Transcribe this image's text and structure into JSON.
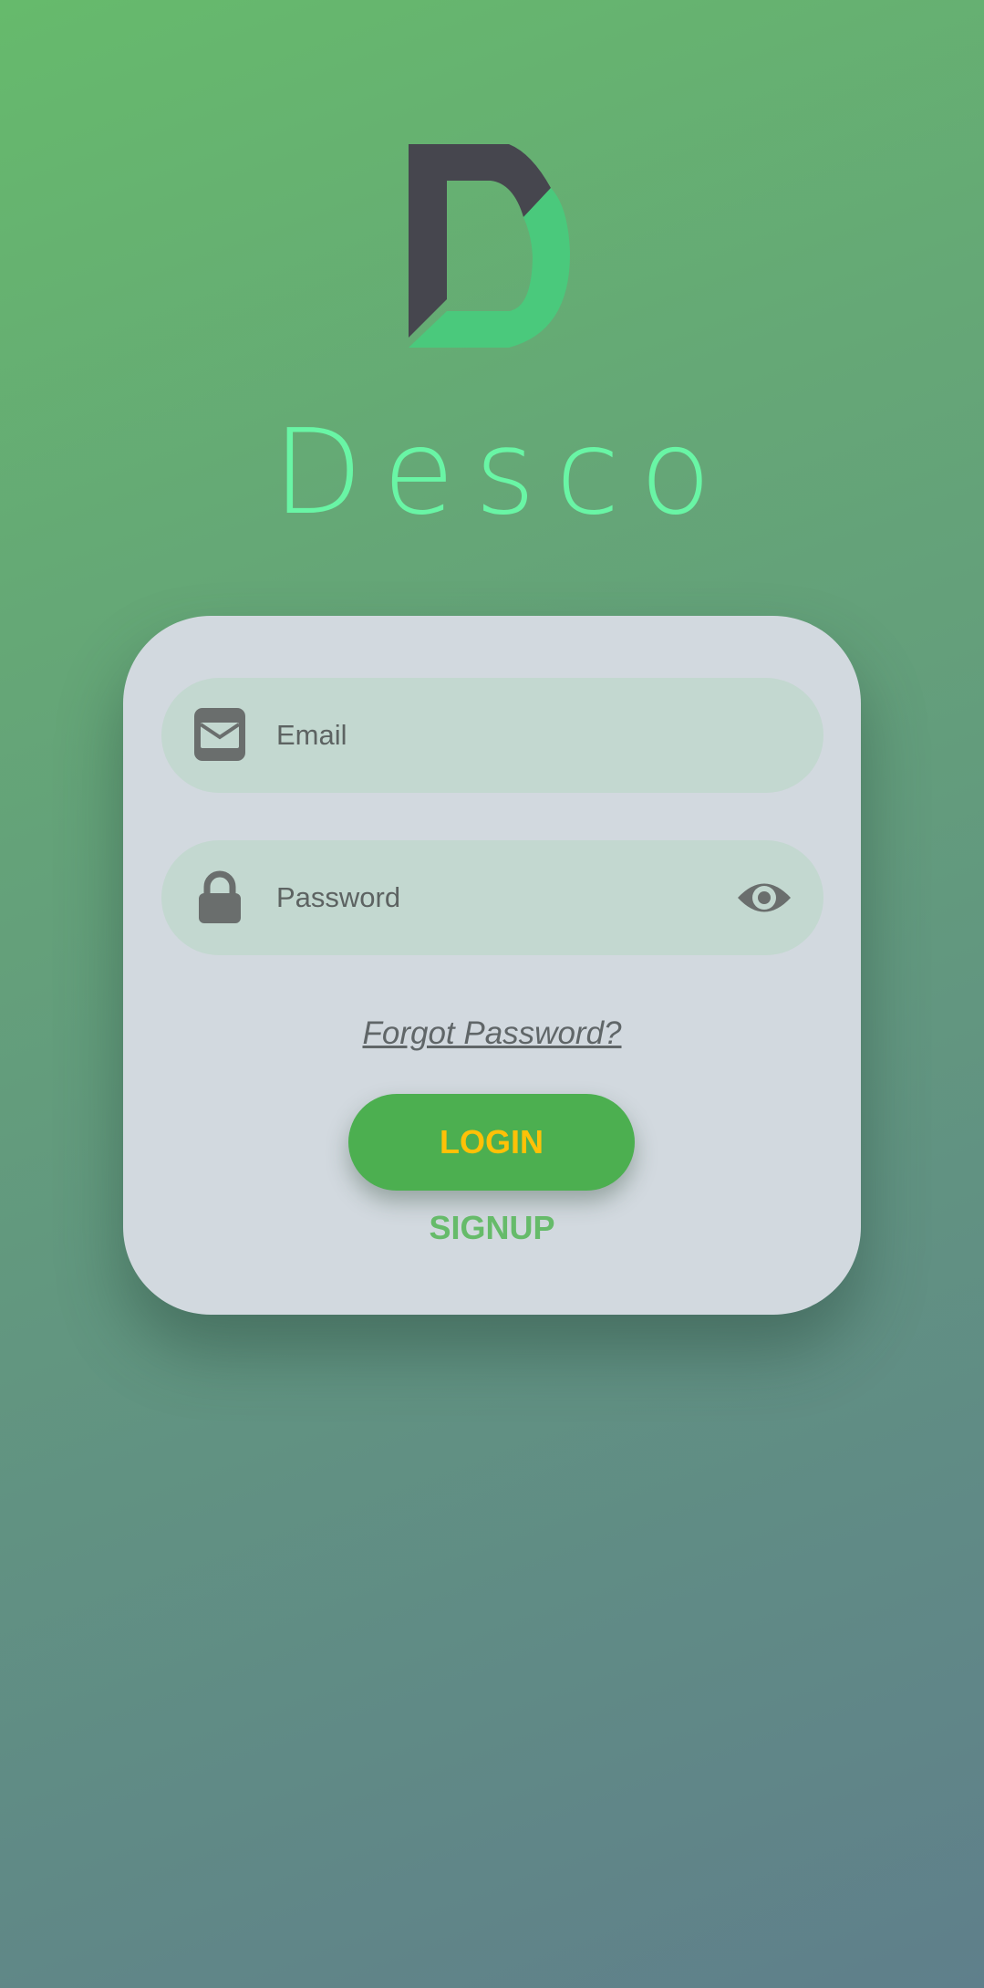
{
  "app": {
    "name": "Desco"
  },
  "login_form": {
    "email_placeholder": "Email",
    "password_placeholder": "Password",
    "forgot_password_label": "Forgot Password?",
    "login_label": "LOGIN",
    "signup_label": "SIGNUP"
  },
  "icons": {
    "logo": "desco-d-logo",
    "email": "envelope-icon",
    "password": "lock-icon",
    "toggle_visibility": "eye-icon"
  },
  "colors": {
    "accent_green": "#4caf50",
    "login_text": "#ffc107",
    "signup_text": "#66bb6a",
    "title_mint": "#69f5a5",
    "logo_dark": "#46464e",
    "logo_green": "#4ac97c"
  }
}
